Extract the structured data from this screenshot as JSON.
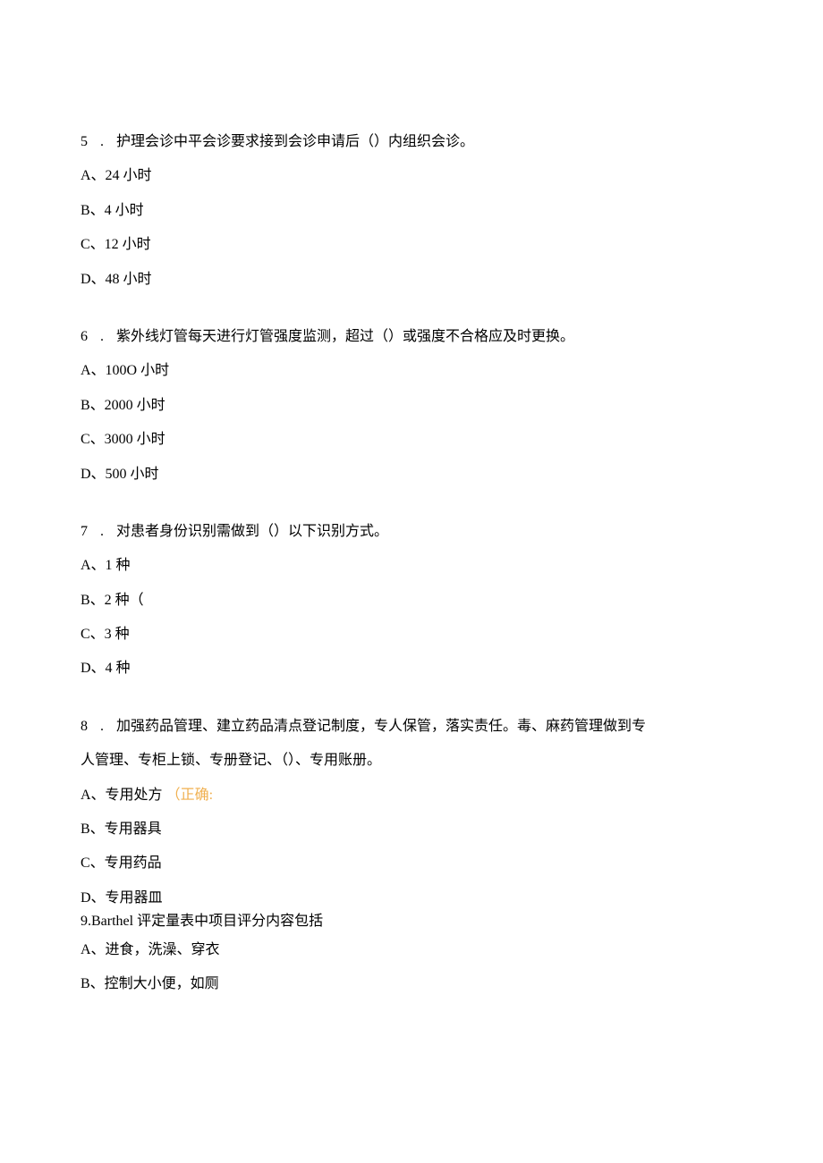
{
  "q5": {
    "num": "5",
    "dot": ".",
    "stem": "护理会诊中平会诊要求接到会诊申请后（）内组织会诊。",
    "A": "A、24 小时",
    "B": "B、4 小时",
    "C": "C、12 小时",
    "D": "D、48 小时"
  },
  "q6": {
    "num": "6",
    "dot": ".",
    "stem": "紫外线灯管每天进行灯管强度监测，超过（）或强度不合格应及时更换。",
    "A": "A、100O 小时",
    "B": "B、2000 小时",
    "C": "C、3000 小时",
    "D": "D、500 小时"
  },
  "q7": {
    "num": "7",
    "dot": ".",
    "stem": "对患者身份识别需做到（）以下识别方式。",
    "A": "A、1 种",
    "B": "B、2 种（",
    "C": "C、3 种",
    "D": "D、4 种"
  },
  "q8": {
    "num": "8",
    "dot": ".",
    "stem1": "加强药品管理、建立药品清点登记制度，专人保管，落实责任。毒、麻药管理做到专",
    "stem2": "人管理、专柜上锁、专册登记、（）、专用账册。",
    "A_label": "A、专用处方",
    "A_correct": "（正确:",
    "B": "B、专用器具",
    "C": "C、专用药品",
    "D": "D、专用器皿"
  },
  "q9": {
    "stem": "9.Barthel 评定量表中项目评分内容包括",
    "A": "A、进食，洗澡、穿衣",
    "B": "B、控制大小便，如厕"
  }
}
